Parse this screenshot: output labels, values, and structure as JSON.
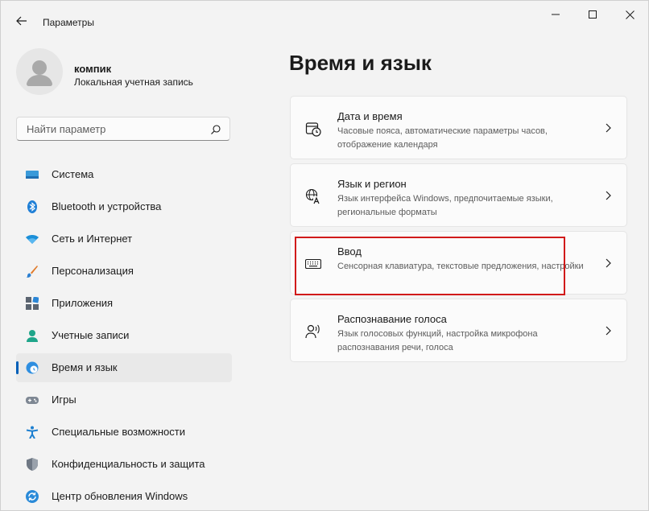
{
  "window": {
    "title": "Параметры"
  },
  "profile": {
    "name": "компик",
    "account_type": "Локальная учетная запись"
  },
  "search": {
    "placeholder": "Найти параметр"
  },
  "nav": [
    {
      "label": "Система",
      "icon": "system-icon"
    },
    {
      "label": "Bluetooth и устройства",
      "icon": "bluetooth-icon"
    },
    {
      "label": "Сеть и Интернет",
      "icon": "wifi-icon"
    },
    {
      "label": "Персонализация",
      "icon": "brush-icon"
    },
    {
      "label": "Приложения",
      "icon": "apps-icon"
    },
    {
      "label": "Учетные записи",
      "icon": "accounts-icon"
    },
    {
      "label": "Время и язык",
      "icon": "time-language-icon",
      "active": true
    },
    {
      "label": "Игры",
      "icon": "gamepad-icon"
    },
    {
      "label": "Специальные возможности",
      "icon": "accessibility-icon"
    },
    {
      "label": "Конфиденциальность и защита",
      "icon": "shield-icon"
    },
    {
      "label": "Центр обновления Windows",
      "icon": "update-icon"
    }
  ],
  "main": {
    "title": "Время и язык",
    "cards": [
      {
        "title": "Дата и время",
        "desc": "Часовые пояса, автоматические параметры часов, отображение календаря",
        "icon": "clock-calendar-icon"
      },
      {
        "title": "Язык и регион",
        "desc": "Язык интерфейса Windows, предпочитаемые языки, региональные форматы",
        "icon": "language-icon"
      },
      {
        "title": "Ввод",
        "desc": "Сенсорная клавиатура, текстовые предложения, настройки",
        "icon": "keyboard-icon"
      },
      {
        "title": "Распознавание голоса",
        "desc": "Язык голосовых функций, настройка микрофона распознавания речи, голоса",
        "icon": "speech-icon"
      }
    ]
  },
  "colors": {
    "accent": "#005fb8",
    "highlight": "#d11a1a",
    "background": "#f3f3f3",
    "card": "#fbfbfb"
  }
}
